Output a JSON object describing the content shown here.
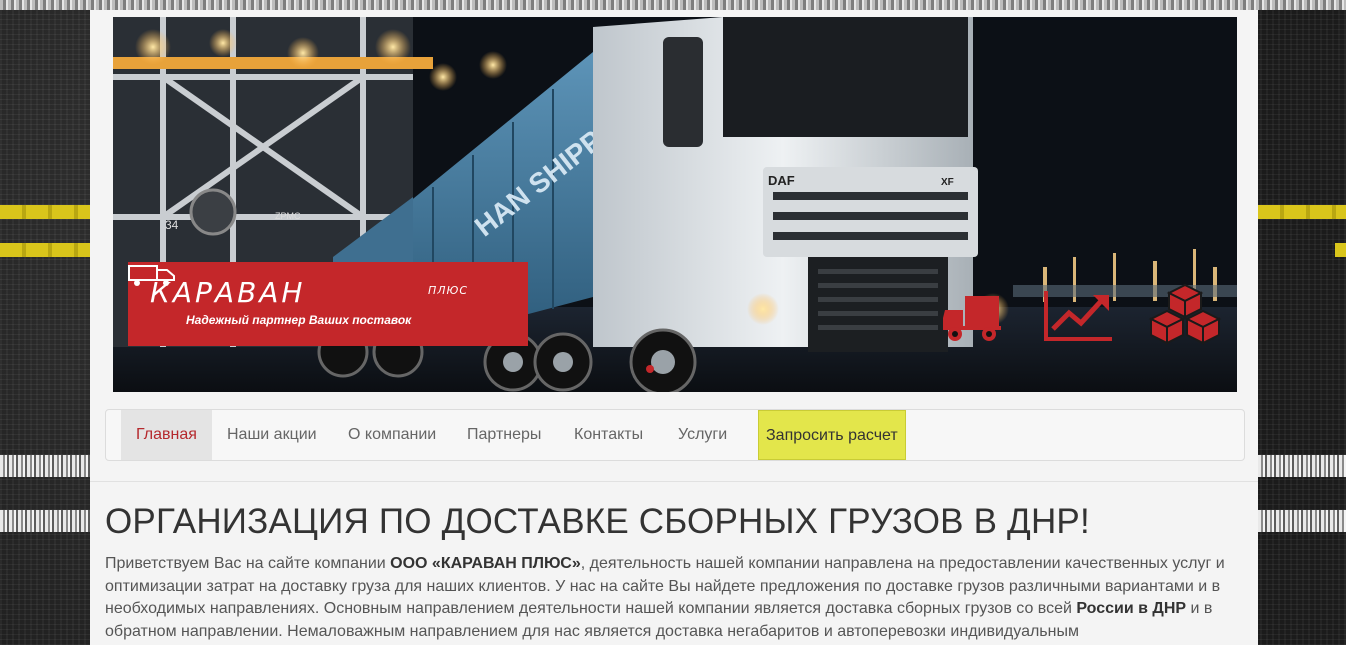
{
  "brand": {
    "name": "КАРАВАН",
    "suffix": "ПЛЮС",
    "tagline": "Надежный партнер Ваших поставок"
  },
  "hero": {
    "truck_badge": "DAF",
    "truck_model": "XF",
    "container_text": "HAN SHIPPING",
    "crane_number": "34",
    "crane_brand": "ZPMC",
    "icons": [
      "truck-icon",
      "chart-up-icon",
      "boxes-icon"
    ],
    "accent_color": "#c4272a"
  },
  "nav": {
    "items": [
      {
        "label": "Главная",
        "active": true
      },
      {
        "label": "Наши акции",
        "active": false
      },
      {
        "label": "О компании",
        "active": false
      },
      {
        "label": "Партнеры",
        "active": false
      },
      {
        "label": "Контакты",
        "active": false
      },
      {
        "label": "Услуги",
        "active": false
      }
    ],
    "cta_label": "Запросить расчет",
    "cta_color": "#e3e64b"
  },
  "content": {
    "title": "ОРГАНИЗАЦИЯ ПО ДОСТАВКЕ СБОРНЫХ ГРУЗОВ В ДНР!",
    "intro_p1": "Приветствуем Вас на сайте компании ",
    "intro_company": "ООО «КАРАВАН ПЛЮС»",
    "intro_p2": ", деятельность нашей компании направлена на предоставлении качественных услуг и оптимизации затрат на доставку груза для наших клиентов. У нас на сайте Вы найдете предложения по доставке грузов различными вариантами и в необходимых направлениях. Основным направлением деятельности нашей компании является доставка сборных грузов со всей ",
    "intro_region": "России в ДНР",
    "intro_p3": " и в обратном направлении. Немаловажным направлением для нас является доставка негабаритов и автоперевозки индивидуальным"
  }
}
